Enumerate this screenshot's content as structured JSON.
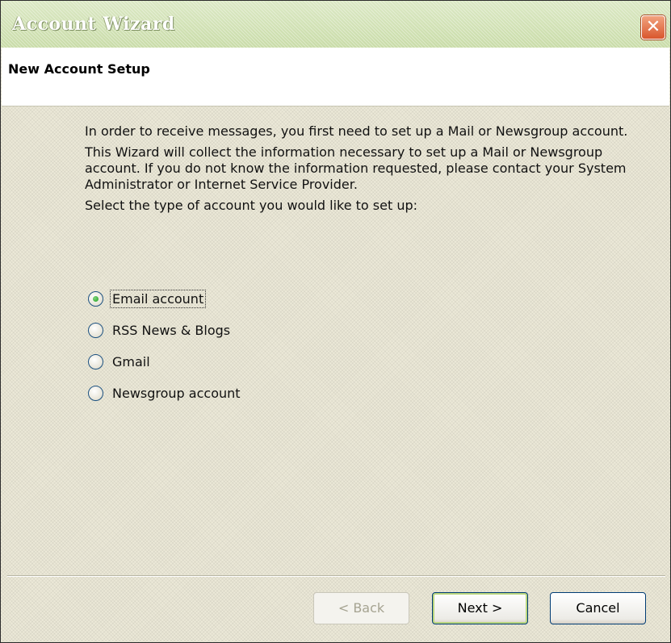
{
  "window": {
    "title": "Account Wizard",
    "close_glyph": "✕"
  },
  "header": {
    "title": "New Account Setup"
  },
  "intro": {
    "paragraph1": "In order to receive messages, you first need to set up a Mail or Newsgroup account.",
    "paragraph2": "This Wizard will collect the information necessary to set up a Mail or Newsgroup account. If you do not know the information requested, please contact your System Administrator or Internet Service Provider.",
    "prompt": "Select the type of account you would like to set up:"
  },
  "account_types": [
    {
      "label": "Email account",
      "selected": true
    },
    {
      "label": "RSS News & Blogs",
      "selected": false
    },
    {
      "label": "Gmail",
      "selected": false
    },
    {
      "label": "Newsgroup account",
      "selected": false
    }
  ],
  "buttons": {
    "back_label": "< Back",
    "next_label": "Next >",
    "cancel_label": "Cancel"
  },
  "colors": {
    "title_bar": "#cfe0b2",
    "dialog_face": "#ece9d8",
    "close_button": "#d9562d",
    "radio_selected": "#21a121"
  }
}
